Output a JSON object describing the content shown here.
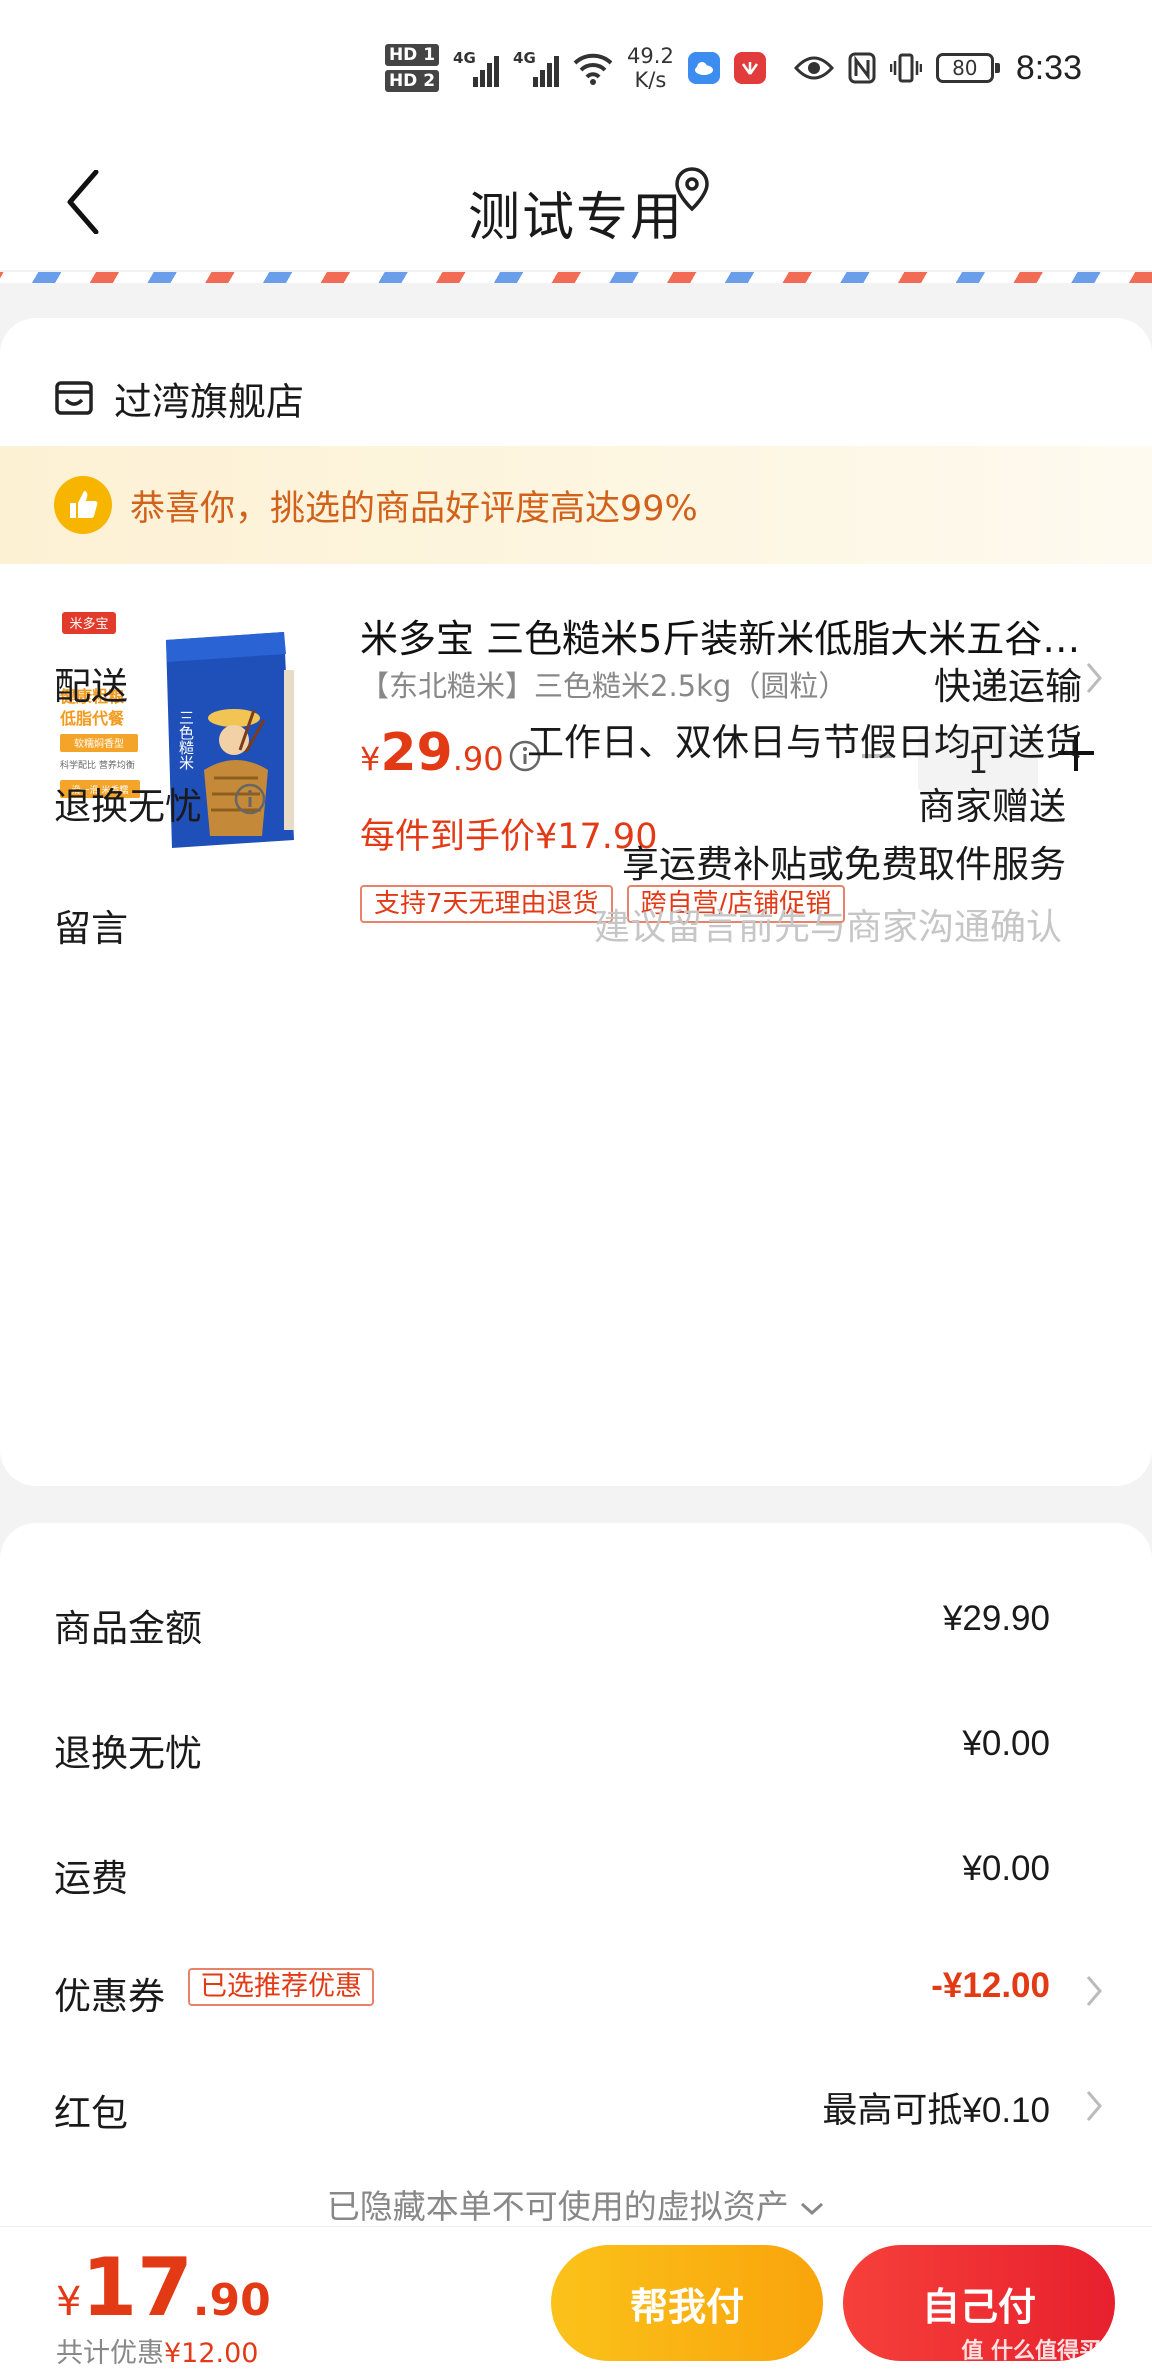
{
  "status_bar": {
    "hd1": "HD 1",
    "hd2": "HD 2",
    "net1": "4G",
    "net2": "4G",
    "speed_value": "49.2",
    "speed_unit": "K/s",
    "battery": "80",
    "time": "8:33"
  },
  "header": {
    "title": "测试专用"
  },
  "store": {
    "name": "过湾旗舰店"
  },
  "banner": {
    "text": "恭喜你，挑选的商品好评度高达99%"
  },
  "product": {
    "title": "米多宝 三色糙米5斤装新米低脂大米五谷…",
    "spec": "【东北糙米】三色糙米2.5kg（圆粒）",
    "price_symbol": "¥",
    "price_int": "29",
    "price_dec": ".90",
    "quantity": "1",
    "unit_price": "每件到手价¥17.90",
    "tags": [
      "支持7天无理由退货",
      "跨自营/店铺促销"
    ],
    "image_labels": {
      "brand": "米多宝",
      "slogan1": "健康粗粮",
      "slogan2": "低脂代餐",
      "badge": "软糯焖香型",
      "sub": "科学配比 营养均衡",
      "strip": "滑一滑 米香糯",
      "pack_text": "三色糙米"
    }
  },
  "delivery": {
    "label": "配送",
    "value": "快递运输",
    "sub": "工作日、双休日与节假日均可送货"
  },
  "return": {
    "label": "退换无忧",
    "value": "商家赠送",
    "sub": "享运费补贴或免费取件服务"
  },
  "message": {
    "label": "留言",
    "placeholder": "建议留言前先与商家沟通确认"
  },
  "summary": {
    "goods_label": "商品金额",
    "goods_value": "¥29.90",
    "return_label": "退换无忧",
    "return_value": "¥0.00",
    "shipping_label": "运费",
    "shipping_value": "¥0.00",
    "coupon_label": "优惠券",
    "coupon_tag": "已选推荐优惠",
    "coupon_value": "-¥12.00",
    "redpacket_label": "红包",
    "redpacket_value": "最高可抵¥0.10",
    "hidden_note": "已隐藏本单不可使用的虚拟资产"
  },
  "footer": {
    "total_symbol": "¥",
    "total_int": "17",
    "total_dec": ".90",
    "saved_prefix": "共计优惠",
    "saved_amount": "¥12.00",
    "help_pay": "帮我付",
    "self_pay": "自己付",
    "watermark": "值 什么值得买"
  },
  "colors": {
    "accent_red": "#e33a16",
    "button_yellow": "#f9a40b",
    "button_red": "#e7202d",
    "banner_text": "#d1611b"
  }
}
